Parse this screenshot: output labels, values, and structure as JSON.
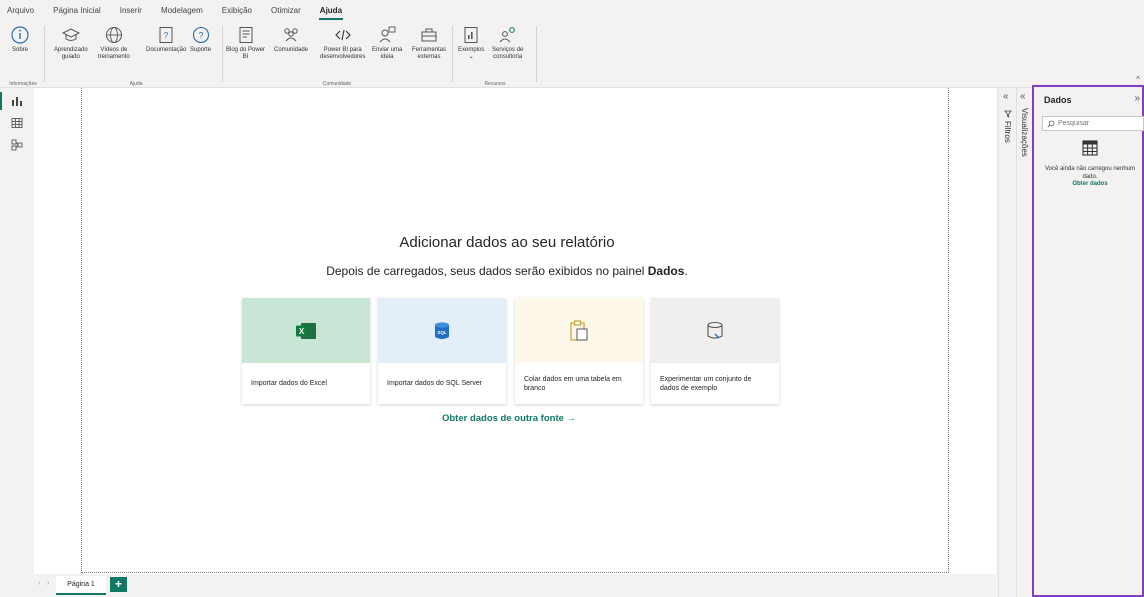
{
  "menu": [
    "Arquivo",
    "Página Inicial",
    "Inserir",
    "Modelagem",
    "Exibição",
    "Otimizar",
    "Ajuda"
  ],
  "menu_active_index": 6,
  "ribbon": {
    "groups": {
      "informacoes": "Informações",
      "ajuda": "Ajuda",
      "comunidade": "Comunidade",
      "recursos": "Recursos"
    },
    "buttons": {
      "sobre": "Sobre",
      "aprendizado": "Aprendizado\nguiado",
      "videos": "Vídeos de\ntreinamento",
      "documentacao": "Documentação",
      "suporte": "Suporte",
      "blog": "Blog do Power\nBI",
      "comunidade": "Comunidade",
      "powerbi_dev": "Power BI para\ndesenvolvedores",
      "enviar_ideia": "Enviar uma\nideia",
      "ferramentas": "Ferramentas\nexternas",
      "exemplos": "Exemplos\n⌄",
      "servicos": "Serviços de\nconsultoria"
    }
  },
  "main": {
    "title": "Adicionar dados ao seu relatório",
    "subtitle_prefix": "Depois de carregados, seus dados serão exibidos no painel ",
    "subtitle_bold": "Dados",
    "subtitle_suffix": ".",
    "cards": [
      {
        "label": "Importar dados do Excel",
        "icon": "excel-icon",
        "bg": "#c8e6d6"
      },
      {
        "label": "Importar dados do SQL Server",
        "icon": "sql-server-icon",
        "bg": "#e3eef9"
      },
      {
        "label": "Colar dados em uma tabela em branco",
        "icon": "paste-icon",
        "bg": "#fdf8ea"
      },
      {
        "label": "Experimentar um conjunto de dados de exemplo",
        "icon": "sample-dataset-icon",
        "bg": "#f1efed"
      }
    ],
    "other_source": "Obter dados de outra fonte →"
  },
  "pages": {
    "tabs": [
      "Página 1"
    ],
    "add": "+"
  },
  "panes": {
    "filtros": "Filtros",
    "visualizacoes": "Visualizações",
    "collapse_arrow": "«"
  },
  "dados": {
    "title": "Dados",
    "expand_arrow": "»",
    "search_placeholder": "Pesquisar",
    "empty_text": "Você ainda não carregou nenhum dado.",
    "link": "Obter dados"
  },
  "colors": {
    "accent": "#117865",
    "highlight_border": "#7f3fbf"
  }
}
